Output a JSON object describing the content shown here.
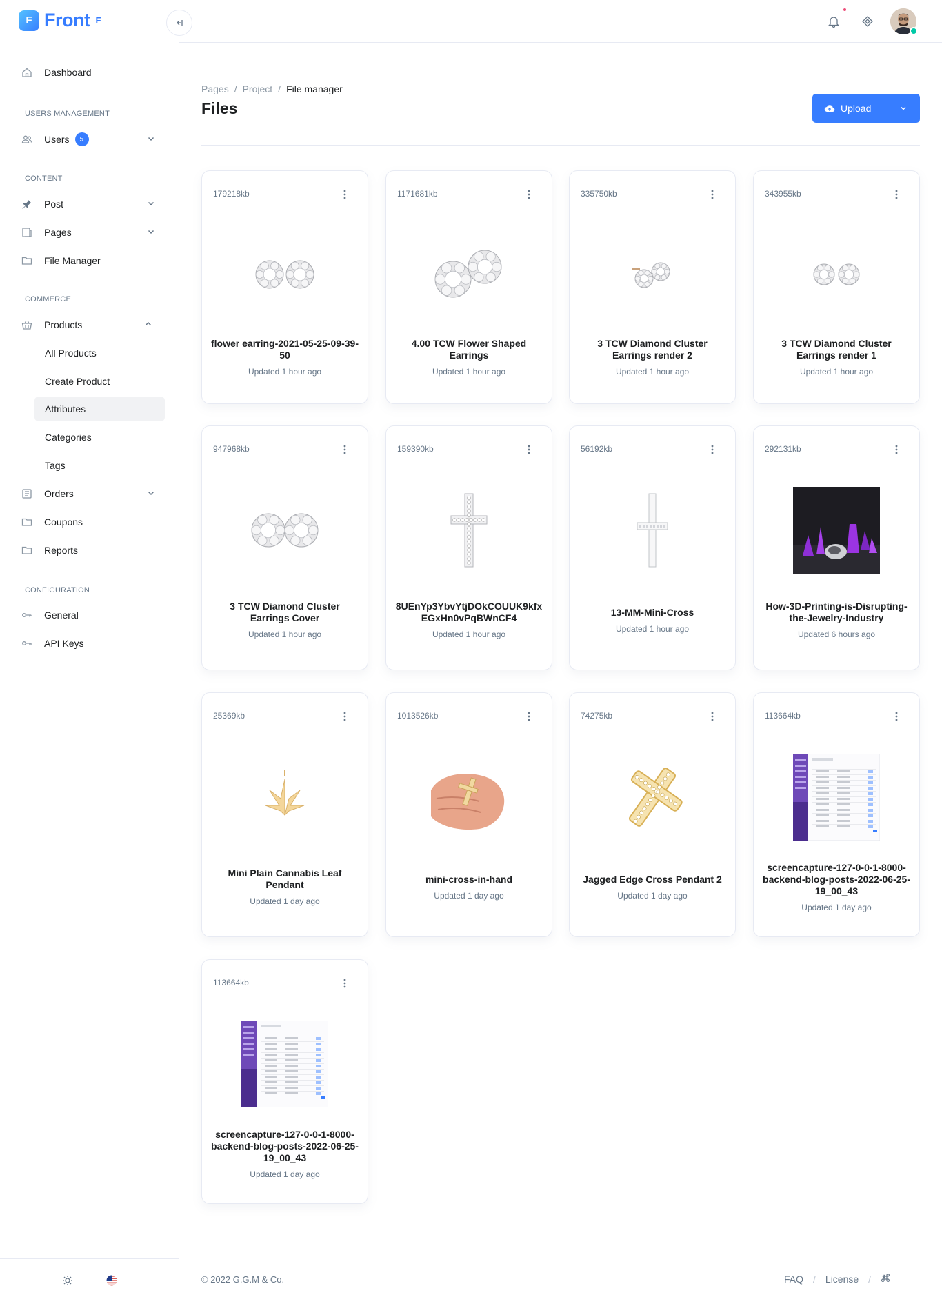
{
  "brand": {
    "name": "Front",
    "mark": "F",
    "sup": "F"
  },
  "sidebar": {
    "dashboard": "Dashboard",
    "sections": {
      "users": "Users management",
      "content": "Content",
      "commerce": "Commerce",
      "configuration": "Configuration"
    },
    "users": {
      "label": "Users",
      "badge": "5"
    },
    "post": "Post",
    "pages": "Pages",
    "file_manager": "File Manager",
    "products": "Products",
    "products_sub": [
      "All Products",
      "Create Product",
      "Attributes",
      "Categories",
      "Tags"
    ],
    "orders": "Orders",
    "coupons": "Coupons",
    "reports": "Reports",
    "general": "General",
    "api_keys": "API Keys"
  },
  "breadcrumb": [
    "Pages",
    "Project",
    "File manager"
  ],
  "page_title": "Files",
  "upload_label": "Upload",
  "files": [
    {
      "size": "179218kb",
      "name": "flower earring-2021-05-25-09-39-50",
      "updated": "Updated 1 hour ago",
      "thumb": "flower-earrings"
    },
    {
      "size": "1171681kb",
      "name": "4.00 TCW Flower Shaped Earrings",
      "updated": "Updated 1 hour ago",
      "thumb": "flower-earrings-large"
    },
    {
      "size": "335750kb",
      "name": "3 TCW Diamond Cluster Earrings render 2",
      "updated": "Updated 1 hour ago",
      "thumb": "cluster-studs-angled"
    },
    {
      "size": "343955kb",
      "name": "3 TCW Diamond Cluster Earrings render 1",
      "updated": "Updated 1 hour ago",
      "thumb": "cluster-studs"
    },
    {
      "size": "947968kb",
      "name": "3 TCW Diamond Cluster Earrings Cover",
      "updated": "Updated 1 hour ago",
      "thumb": "cluster-earrings-cover"
    },
    {
      "size": "159390kb",
      "name": "8UEnYp3YbvYtjDOkCOUUK9kfxEGxHn0vPqBWnCF4",
      "updated": "Updated 1 hour ago",
      "thumb": "diamond-cross"
    },
    {
      "size": "56192kb",
      "name": "13-MM-Mini-Cross",
      "updated": "Updated 1 hour ago",
      "thumb": "mini-cross"
    },
    {
      "size": "292131kb",
      "name": "How-3D-Printing-is-Disrupting-the-Jewelry-Industry",
      "updated": "Updated 6 hours ago",
      "thumb": "3d-printing-photo"
    },
    {
      "size": "25369kb",
      "name": "Mini Plain Cannabis Leaf Pendant",
      "updated": "Updated 1 day ago",
      "thumb": "cannabis-leaf"
    },
    {
      "size": "1013526kb",
      "name": "mini-cross-in-hand",
      "updated": "Updated 1 day ago",
      "thumb": "cross-in-hand"
    },
    {
      "size": "74275kb",
      "name": "Jagged Edge Cross Pendant 2",
      "updated": "Updated 1 day ago",
      "thumb": "gold-cross"
    },
    {
      "size": "113664kb",
      "name": "screencapture-127-0-0-1-8000-backend-blog-posts-2022-06-25-19_00_43",
      "updated": "Updated 1 day ago",
      "thumb": "screenshot"
    },
    {
      "size": "113664kb",
      "name": "screencapture-127-0-0-1-8000-backend-blog-posts-2022-06-25-19_00_43",
      "updated": "Updated 1 day ago",
      "thumb": "screenshot"
    }
  ],
  "footer": {
    "copyright": "© 2022 G.G.M & Co.",
    "faq": "FAQ",
    "license": "License"
  },
  "colors": {
    "primary": "#377dff",
    "text": "#1e2022",
    "muted": "#677788",
    "border": "#e7eaf3"
  }
}
